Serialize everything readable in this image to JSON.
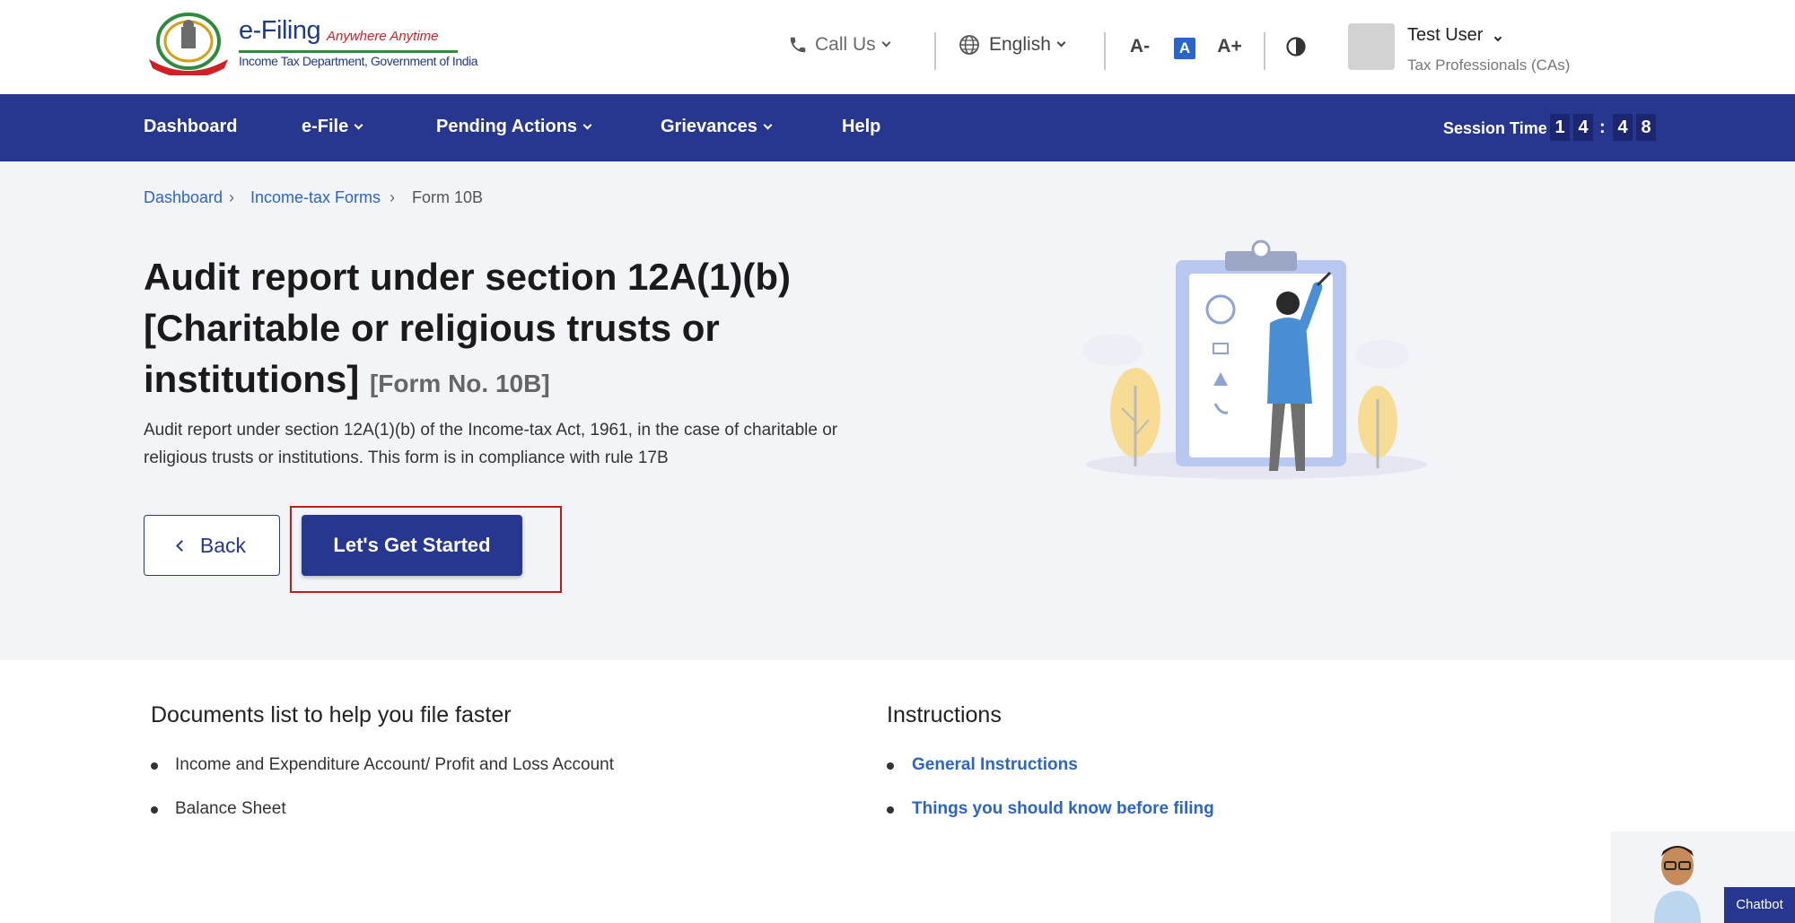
{
  "header": {
    "logo_title": "e-Filing",
    "logo_tagline": "Anywhere Anytime",
    "logo_subtitle": "Income Tax Department, Government of India",
    "call_us": "Call Us",
    "language": "English",
    "font_decrease": "A-",
    "font_default": "A",
    "font_increase": "A+",
    "user_name": "Test User",
    "user_role": "Tax Professionals (CAs)"
  },
  "nav": {
    "items": [
      {
        "label": "Dashboard",
        "dropdown": false
      },
      {
        "label": "e-File",
        "dropdown": true
      },
      {
        "label": "Pending Actions",
        "dropdown": true
      },
      {
        "label": "Grievances",
        "dropdown": true
      },
      {
        "label": "Help",
        "dropdown": false
      }
    ],
    "session_label": "Session Time",
    "session_digits": [
      "1",
      "4",
      "4",
      "8"
    ]
  },
  "breadcrumb": [
    "Dashboard",
    "Income-tax Forms",
    "Form 10B"
  ],
  "hero": {
    "title": "Audit report under section 12A(1)(b) [Charitable or religious trusts or institutions]",
    "form_no": "[Form No. 10B]",
    "description": "Audit report under section 12A(1)(b) of the Income-tax Act, 1961, in the case of charitable or religious trusts or institutions. This form is in compliance with rule 17B",
    "back_label": "Back",
    "start_label": "Let's Get Started"
  },
  "documents": {
    "title": "Documents list to help you file faster",
    "items": [
      "Income and Expenditure Account/ Profit and Loss Account",
      "Balance Sheet"
    ]
  },
  "instructions": {
    "title": "Instructions",
    "items": [
      "General Instructions",
      "Things you should know before filing"
    ]
  },
  "chatbot": {
    "label": "Chatbot"
  },
  "icons": {
    "phone": "phone-icon",
    "globe": "globe-icon",
    "contrast": "contrast-icon"
  },
  "colors": {
    "nav_bg": "#27368f",
    "link": "#2b65c9",
    "highlight": "#c31a1a"
  }
}
